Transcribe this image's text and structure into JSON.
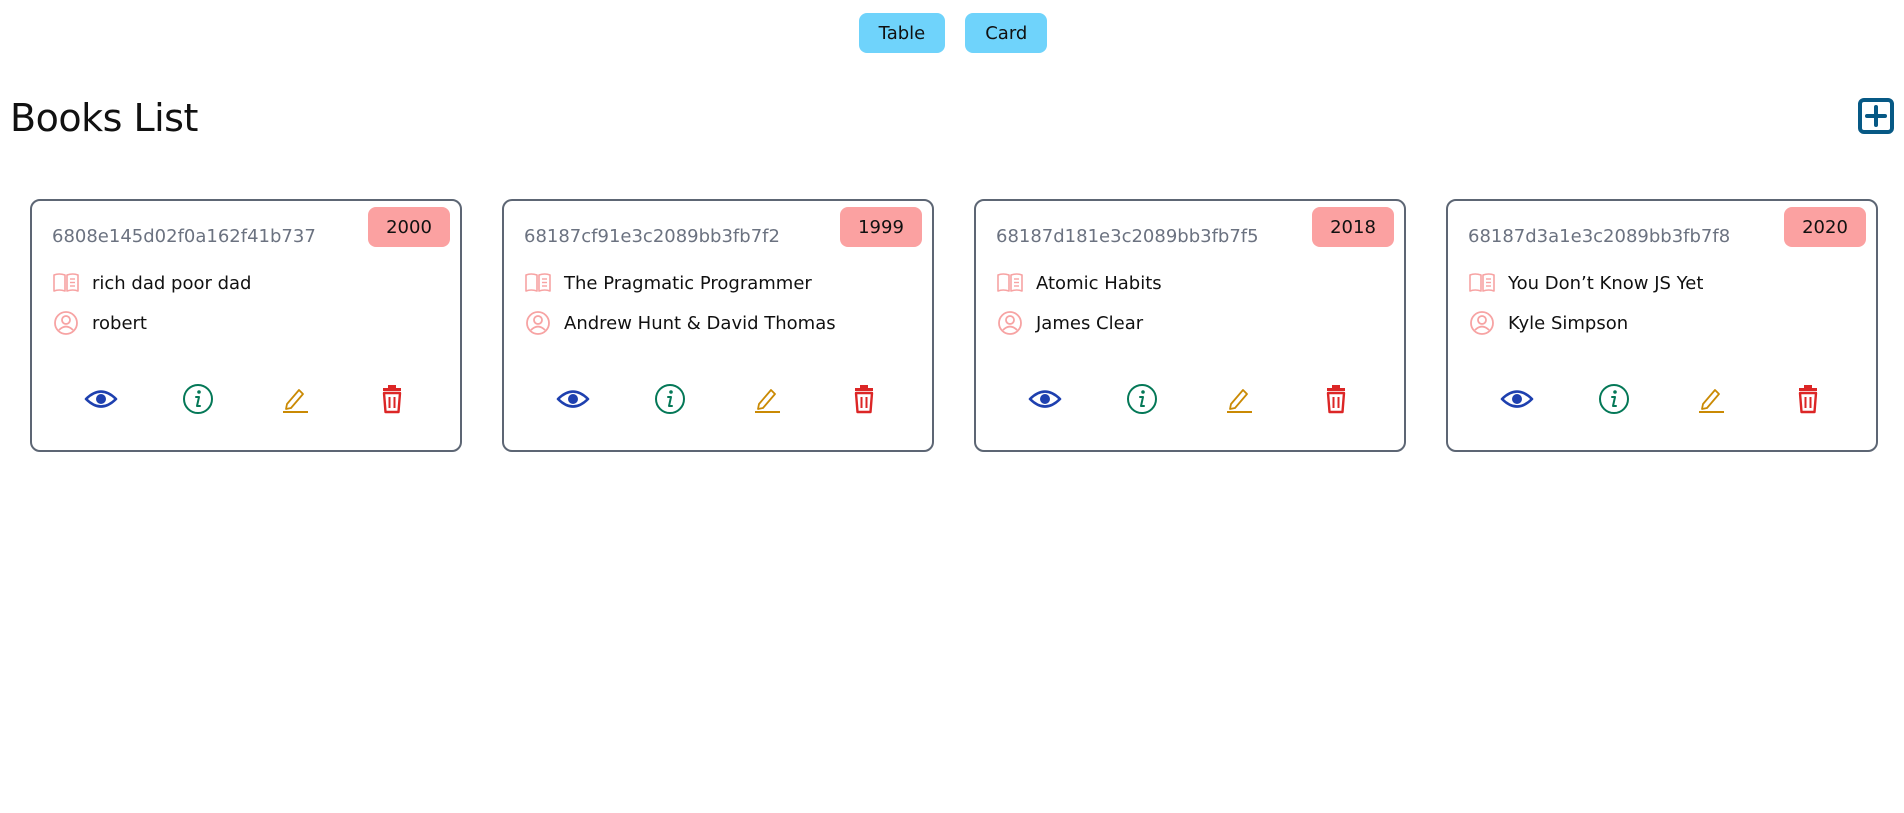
{
  "view_toggle": {
    "table_label": "Table",
    "card_label": "Card"
  },
  "page": {
    "title": "Books List",
    "add_icon": "plus-square-icon"
  },
  "icons": {
    "title": "book-open-icon",
    "author": "user-circle-icon",
    "view": "eye-icon",
    "info": "info-circle-icon",
    "edit": "pencil-icon",
    "delete": "trash-icon"
  },
  "colors": {
    "toggle_button": "#6fd3fb",
    "year_badge": "#fba1a1",
    "meta_icon": "#f7a3a3",
    "view": "#1e40af",
    "info": "#047857",
    "edit": "#ca8a04",
    "delete": "#dc2626",
    "add": "#075985"
  },
  "books": [
    {
      "id": "6808e145d02f0a162f41b737",
      "year": "2000",
      "title": "rich dad poor dad",
      "author": "robert"
    },
    {
      "id": "68187cf91e3c2089bb3fb7f2",
      "year": "1999",
      "title": "The Pragmatic Programmer",
      "author": "Andrew Hunt & David Thomas"
    },
    {
      "id": "68187d181e3c2089bb3fb7f5",
      "year": "2018",
      "title": "Atomic Habits",
      "author": "James Clear"
    },
    {
      "id": "68187d3a1e3c2089bb3fb7f8",
      "year": "2020",
      "title": "You Don’t Know JS Yet",
      "author": "Kyle Simpson"
    }
  ]
}
